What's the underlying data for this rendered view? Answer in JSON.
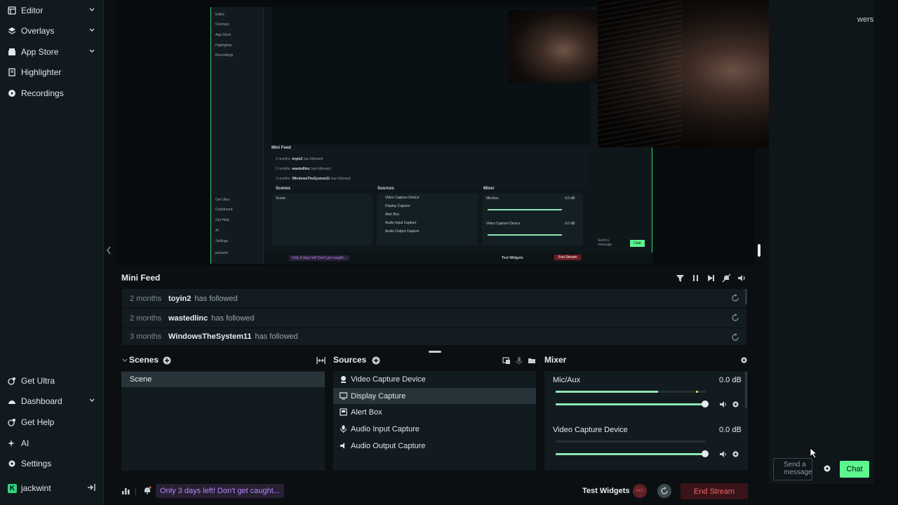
{
  "sidebar": {
    "items": [
      {
        "label": "Editor",
        "icon": "editor-icon"
      },
      {
        "label": "Overlays",
        "icon": "overlays-icon"
      },
      {
        "label": "App Store",
        "icon": "store-icon"
      },
      {
        "label": "Highlighter",
        "icon": "highlighter-icon"
      },
      {
        "label": "Recordings",
        "icon": "recordings-icon"
      }
    ],
    "bottom_items": [
      {
        "label": "Get Ultra",
        "icon": "ultra-icon"
      },
      {
        "label": "Dashboard",
        "icon": "dashboard-icon"
      },
      {
        "label": "Get Help",
        "icon": "help-icon"
      },
      {
        "label": "AI",
        "icon": "ai-icon"
      },
      {
        "label": "Settings",
        "icon": "gear-icon"
      }
    ],
    "user": "jackwint"
  },
  "capture": {
    "nav": [
      "Editor",
      "Overlays",
      "App Store",
      "Highlighter",
      "Recordings"
    ],
    "nav_bottom": [
      "Get Ultra",
      "Dashboard",
      "Get Help",
      "AI",
      "Settings",
      "jackwint"
    ],
    "mini_feed_title": "Mini Feed",
    "feed": [
      {
        "time": "2 months",
        "user": "toyin2",
        "action": "has followed"
      },
      {
        "time": "2 months",
        "user": "wastedlinc",
        "action": "has followed"
      },
      {
        "time": "3 months",
        "user": "WindowsTheSystem11",
        "action": "has followed"
      }
    ],
    "scenes_title": "Scenes",
    "scene": "Scene",
    "sources_title": "Sources",
    "sources": [
      "Video Capture Device",
      "Display Capture",
      "Alert Box",
      "Audio Input Capture",
      "Audio Output Capture"
    ],
    "mixer_title": "Mixer",
    "mixer": [
      {
        "name": "Mic/Aux",
        "db": "0.0 dB"
      },
      {
        "name": "Video Capture Device",
        "db": "0.0 dB"
      }
    ],
    "promo": "Only 3 days left! Don't get caught...",
    "test_widgets": "Test Widgets",
    "end_stream": "End Stream",
    "chat": "Chat",
    "send": "Send a message"
  },
  "right": {
    "viewers_partial": "wers",
    "chat_placeholder": "Send a message",
    "chat_button": "Chat"
  },
  "minifeed": {
    "title": "Mini Feed",
    "rows": [
      {
        "time": "2 months",
        "user": "toyin2",
        "action": "has followed"
      },
      {
        "time": "2 months",
        "user": "wastedlinc",
        "action": "has followed"
      },
      {
        "time": "3 months",
        "user": "WindowsTheSystem11",
        "action": "has followed"
      }
    ]
  },
  "scenes": {
    "title": "Scenes",
    "items": [
      "Scene"
    ]
  },
  "sources": {
    "title": "Sources",
    "items": [
      {
        "label": "Video Capture Device",
        "icon": "webcam-icon"
      },
      {
        "label": "Display Capture",
        "icon": "monitor-icon"
      },
      {
        "label": "Alert Box",
        "icon": "alert-box-icon"
      },
      {
        "label": "Audio Input Capture",
        "icon": "microphone-icon"
      },
      {
        "label": "Audio Output Capture",
        "icon": "speaker-icon"
      }
    ]
  },
  "mixer": {
    "title": "Mixer",
    "channels": [
      {
        "name": "Mic/Aux",
        "db": "0.0 dB",
        "level": 0.73,
        "volume": 1.0
      },
      {
        "name": "Video Capture Device",
        "db": "0.0 dB",
        "level": 0.0,
        "volume": 1.0
      }
    ]
  },
  "bottom": {
    "promo": "Only 3 days left! Don't get caught...",
    "test_widgets": "Test Widgets",
    "rec": "REC",
    "end_stream": "End Stream"
  },
  "colors": {
    "accent": "#5cf58f",
    "brand_green": "#2fd67e",
    "end_stream": "#f0646c",
    "promo": "#b784ff"
  }
}
